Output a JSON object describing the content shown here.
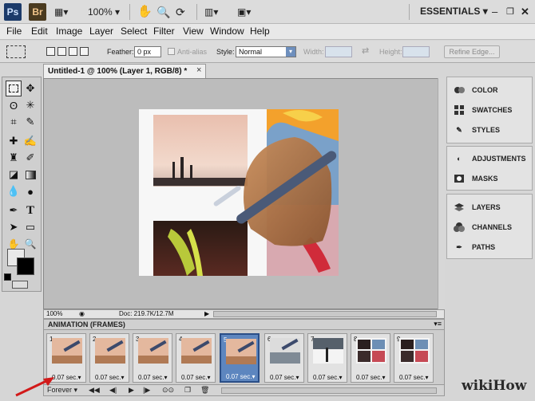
{
  "appbar": {
    "ps_label": "Ps",
    "br_label": "Br",
    "zoom": "100%",
    "workspace": "ESSENTIALS"
  },
  "menu": [
    "File",
    "Edit",
    "Image",
    "Layer",
    "Select",
    "Filter",
    "View",
    "Window",
    "Help"
  ],
  "options": {
    "feather_label": "Feather:",
    "feather_value": "0 px",
    "antialias_label": "Anti-alias",
    "style_label": "Style:",
    "style_value": "Normal",
    "width_label": "Width:",
    "height_label": "Height:",
    "refine_edge": "Refine Edge..."
  },
  "document": {
    "tab_title": "Untitled-1 @ 100% (Layer 1, RGB/8) *",
    "close_glyph": "×",
    "zoom_status": "100%",
    "doc_status": "Doc: 219.7K/12.7M"
  },
  "right_panels": {
    "group1": [
      "COLOR",
      "SWATCHES",
      "STYLES"
    ],
    "group2": [
      "ADJUSTMENTS",
      "MASKS"
    ],
    "group3": [
      "LAYERS",
      "CHANNELS",
      "PATHS"
    ]
  },
  "animation": {
    "title": "ANIMATION (FRAMES)",
    "loop_value": "Forever",
    "frames": [
      {
        "num": "1",
        "delay": "0.07 sec."
      },
      {
        "num": "2",
        "delay": "0.07 sec."
      },
      {
        "num": "3",
        "delay": "0.07 sec."
      },
      {
        "num": "4",
        "delay": "0.07 sec."
      },
      {
        "num": "5",
        "delay": "0.07 sec."
      },
      {
        "num": "6",
        "delay": "0.07 sec."
      },
      {
        "num": "7",
        "delay": "0.07 sec."
      },
      {
        "num": "8",
        "delay": "0.07 sec."
      },
      {
        "num": "9",
        "delay": "0.07 sec."
      }
    ],
    "selected_frame": 5
  },
  "watermark": "wikiHow",
  "colors": {
    "selection_blue": "#5d86bf",
    "ps_blue": "#1c3b6a",
    "arrow_red": "#d21a1a"
  }
}
